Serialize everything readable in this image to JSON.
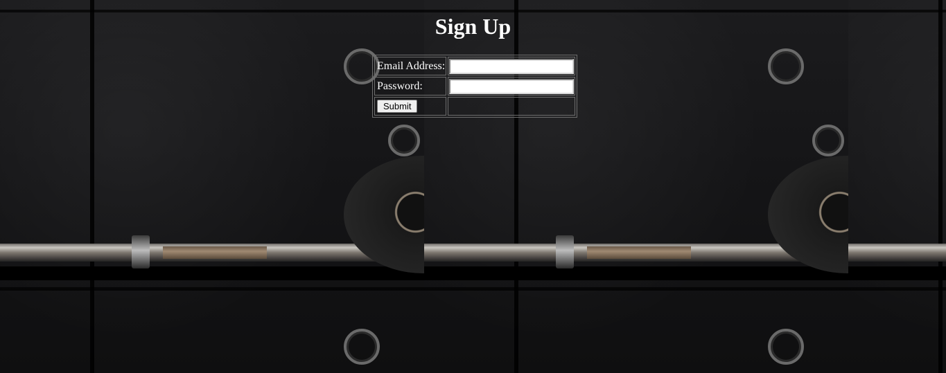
{
  "page": {
    "title": "Sign Up"
  },
  "form": {
    "email_label": "Email Address:",
    "email_value": "",
    "password_label": "Password:",
    "password_value": "",
    "submit_label": "Submit"
  },
  "colors": {
    "text": "#ffffff",
    "table_border": "#6e6e6e",
    "background": "#0b0b0c"
  }
}
